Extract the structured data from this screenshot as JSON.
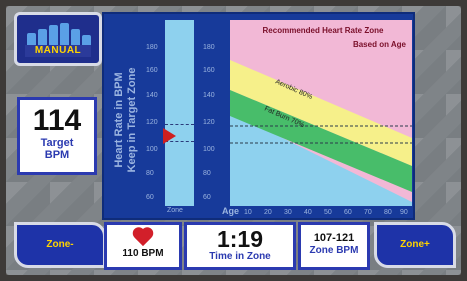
{
  "manual_button": {
    "label": "MANUAL"
  },
  "target": {
    "value": "114",
    "label_line1": "Target",
    "label_line2": "BPM"
  },
  "y_axis_label": {
    "line1": "Heart Rate in BPM",
    "line2": "Keep in Target Zone"
  },
  "zone_strip": {
    "label": "Zone"
  },
  "y_ticks": [
    "180",
    "160",
    "140",
    "120",
    "100",
    "80",
    "60"
  ],
  "chart_title": {
    "line1": "Recommended Heart Rate Zone",
    "line2": "Based on Age"
  },
  "bands": [
    {
      "name": "Aerobic 80%",
      "color": "#f6f08a"
    },
    {
      "name": "Fat Burn 70%",
      "color": "#48bd6a"
    }
  ],
  "x_axis": {
    "label": "Age",
    "ticks": [
      "10",
      "20",
      "30",
      "40",
      "50",
      "60",
      "70",
      "80",
      "90"
    ]
  },
  "colors": {
    "panel_blue": "#173a9a",
    "chart_pink": "#f2b8d6",
    "chart_cyan": "#8ed1ee"
  },
  "bottom": {
    "zone_minus": "Zone-",
    "heart_rate": "110 BPM",
    "time_value": "1:19",
    "time_caption": "Time in Zone",
    "zone_range": "107-121",
    "zone_caption": "Zone BPM",
    "zone_plus": "Zone+"
  },
  "current_zone": {
    "low": 107,
    "high": 121,
    "target": 114
  }
}
